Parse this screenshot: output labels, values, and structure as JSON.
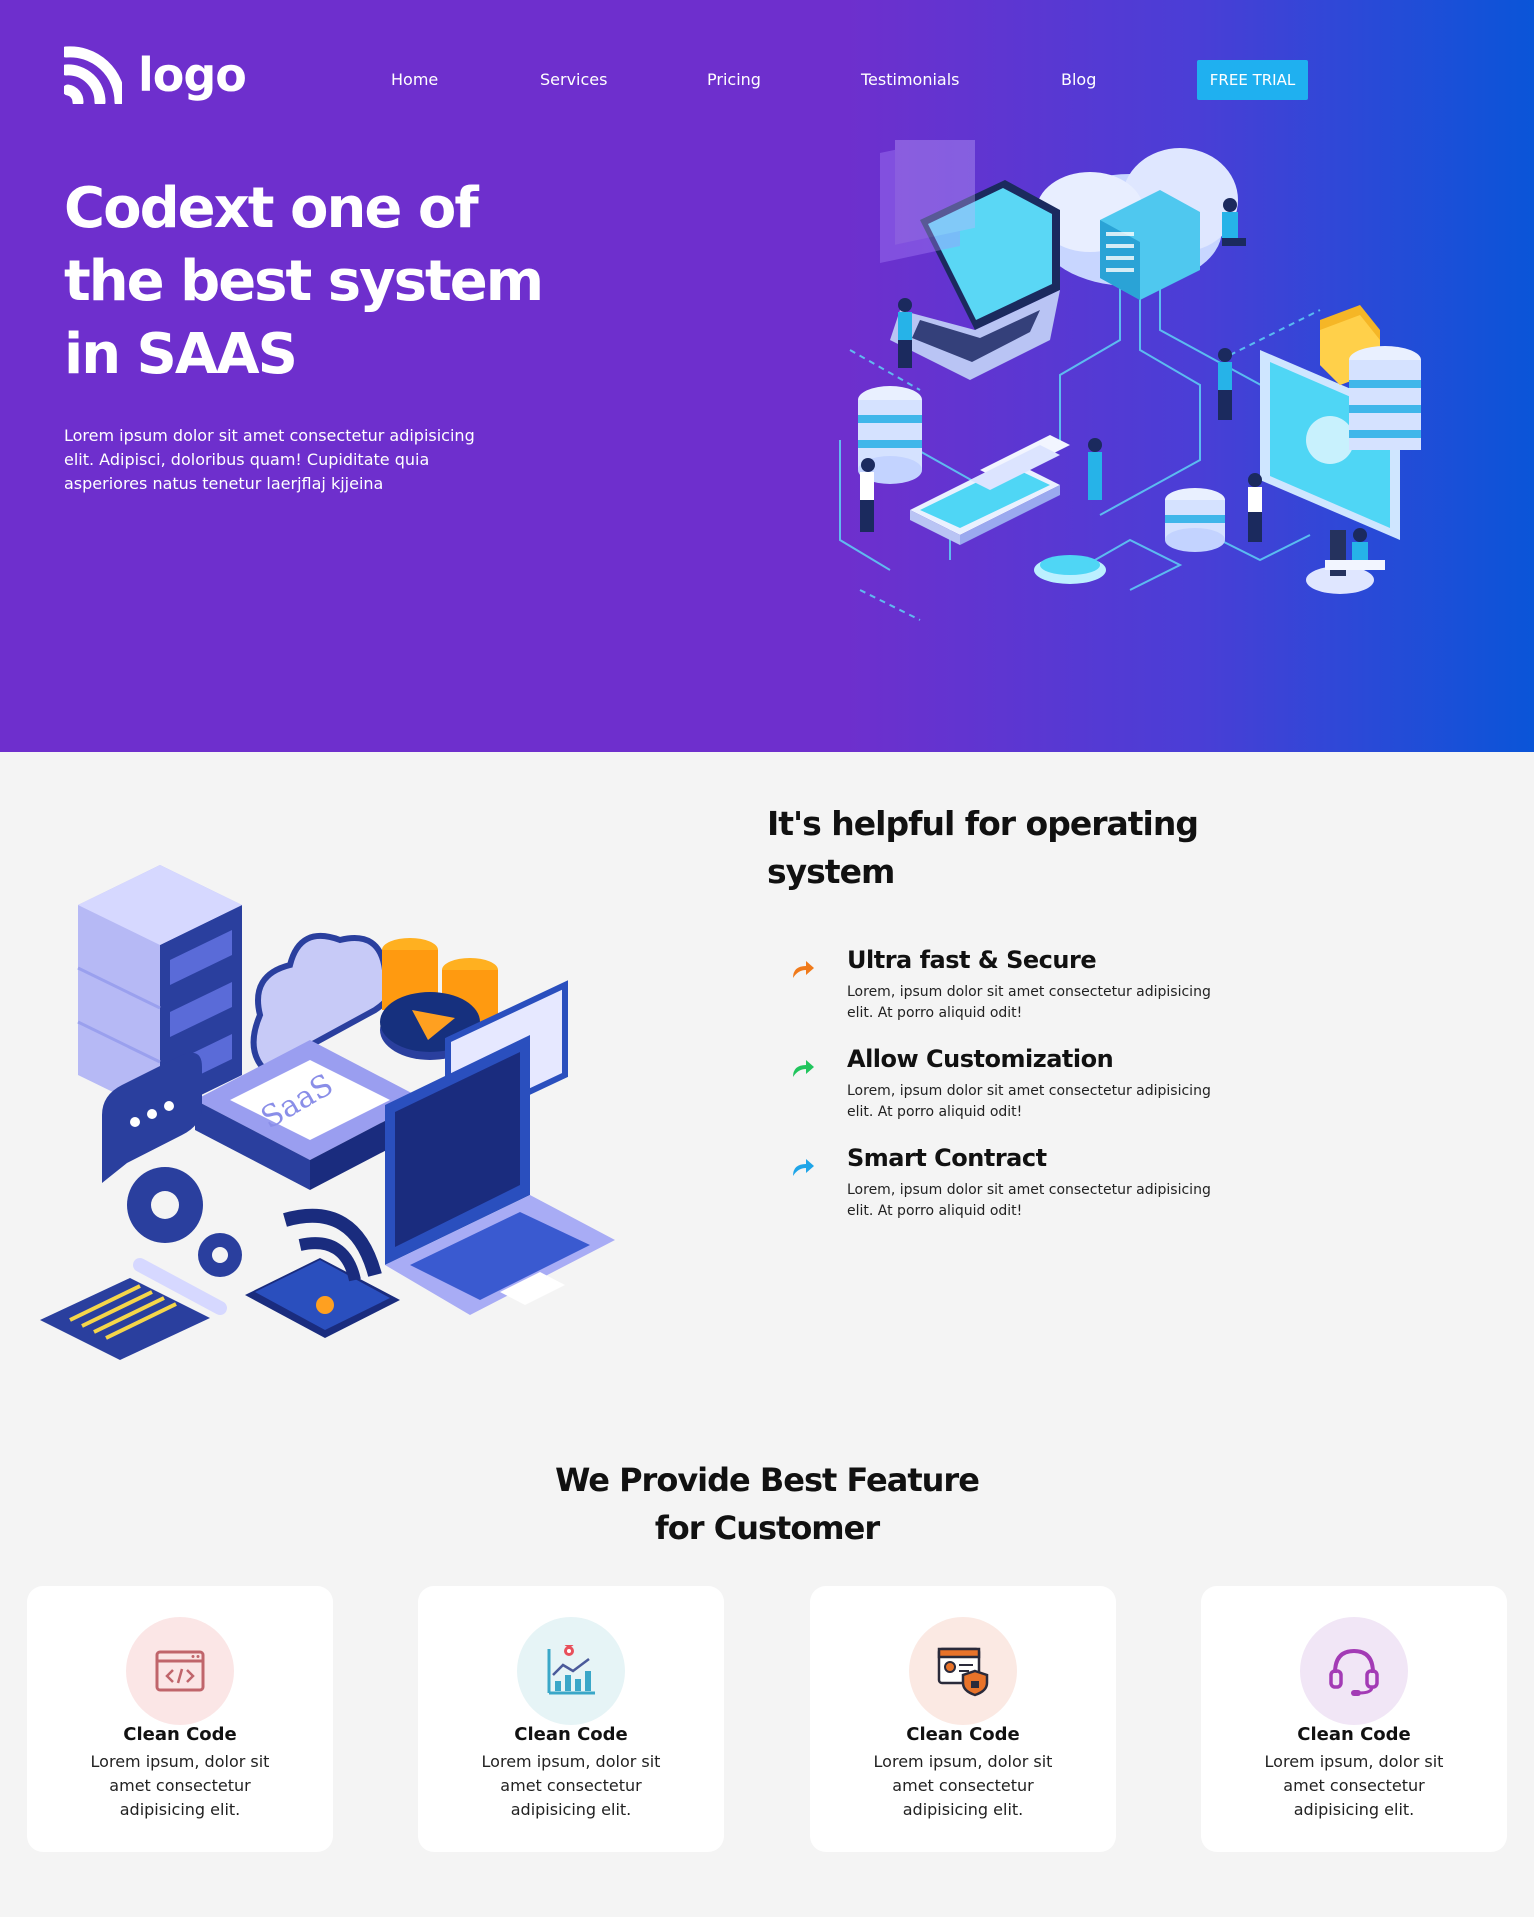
{
  "header": {
    "logo_text": "logo",
    "nav": [
      {
        "label": "Home"
      },
      {
        "label": "Services"
      },
      {
        "label": "Pricing"
      },
      {
        "label": "Testimonials"
      },
      {
        "label": "Blog"
      }
    ],
    "cta_label": "FREE TRIAL"
  },
  "hero": {
    "title_lines": [
      "Codext one of",
      "the best system",
      "in SAAS"
    ],
    "subtitle_lines": [
      "Lorem ipsum dolor sit amet consectetur adipisicing",
      "elit. Adipisci, doloribus quam! Cupiditate quia",
      "asperiores natus tenetur laerjflaj kjjeina"
    ]
  },
  "operating": {
    "title_lines": [
      "It's helpful for operating",
      "system"
    ],
    "illustration_label": "SaaS",
    "features": [
      {
        "title": "Ultra fast & Secure",
        "desc_lines": [
          "Lorem, ipsum dolor sit amet consectetur adipisicing",
          "elit. At porro aliquid odit!"
        ],
        "icon": "arrow-icon",
        "color": "#f07a1a"
      },
      {
        "title": "Allow Customization",
        "desc_lines": [
          "Lorem, ipsum dolor sit amet consectetur adipisicing",
          "elit. At porro aliquid odit!"
        ],
        "icon": "arrow-icon",
        "color": "#21c55d"
      },
      {
        "title": "Smart Contract",
        "desc_lines": [
          "Lorem, ipsum dolor sit amet consectetur adipisicing",
          "elit. At porro aliquid odit!"
        ],
        "icon": "arrow-icon",
        "color": "#1fa5e8"
      }
    ]
  },
  "features_section": {
    "title_lines": [
      "We Provide Best Feature",
      "for Customer"
    ],
    "cards": [
      {
        "title": "Clean Code",
        "desc_lines": [
          "Lorem ipsum, dolor sit",
          "amet consectetur",
          "adipisicing elit."
        ],
        "icon": "code-window-icon",
        "bg": "#fbe6e6",
        "color": "#c0656b"
      },
      {
        "title": "Clean Code",
        "desc_lines": [
          "Lorem ipsum, dolor sit",
          "amet consectetur",
          "adipisicing elit."
        ],
        "icon": "chart-icon",
        "bg": "#e6f4f6",
        "color": "#3aa7c8"
      },
      {
        "title": "Clean Code",
        "desc_lines": [
          "Lorem ipsum, dolor sit",
          "amet consectetur",
          "adipisicing elit."
        ],
        "icon": "profile-shield-icon",
        "bg": "#fbe9e3",
        "color": "#e8732a"
      },
      {
        "title": "Clean Code",
        "desc_lines": [
          "Lorem ipsum, dolor sit",
          "amet consectetur",
          "adipisicing elit."
        ],
        "icon": "headset-icon",
        "bg": "#f1e6f6",
        "color": "#a33bb5"
      }
    ]
  }
}
